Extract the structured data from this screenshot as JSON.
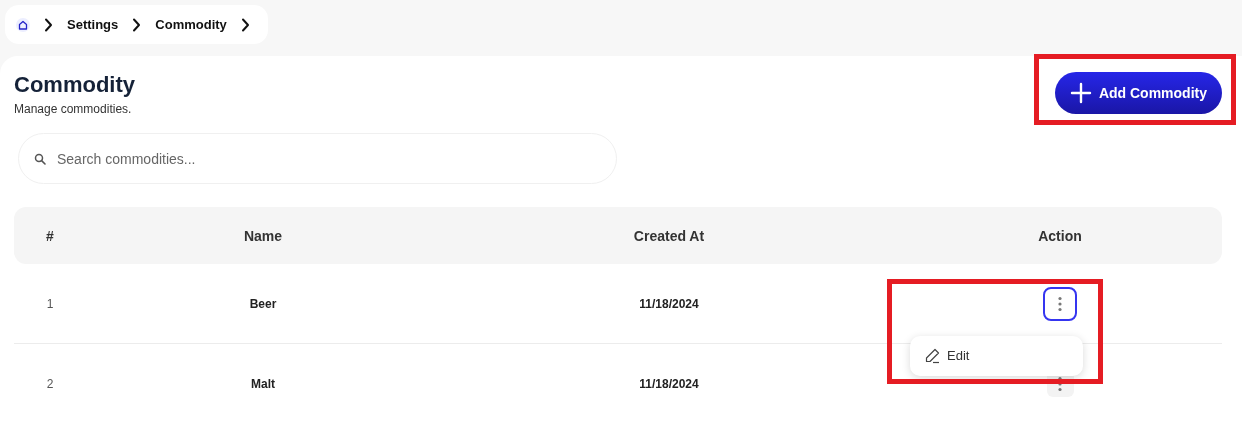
{
  "breadcrumb": [
    {
      "kind": "home"
    },
    {
      "kind": "link",
      "label": "Settings"
    },
    {
      "kind": "link",
      "label": "Commodity"
    }
  ],
  "header": {
    "title": "Commodity",
    "subtitle": "Manage commodities."
  },
  "add_button": {
    "label": "Add Commodity",
    "highlighted": true
  },
  "search": {
    "placeholder": "Search commodities..."
  },
  "table": {
    "columns": [
      "#",
      "Name",
      "Created At",
      "Action"
    ],
    "rows": [
      {
        "index": "1",
        "name": "Beer",
        "created_at": "11/18/2024",
        "menu_open": true,
        "highlighted": true,
        "menu": [
          "Edit"
        ]
      },
      {
        "index": "2",
        "name": "Malt",
        "created_at": "11/18/2024",
        "menu_open": false,
        "highlighted": false,
        "menu": []
      }
    ]
  }
}
